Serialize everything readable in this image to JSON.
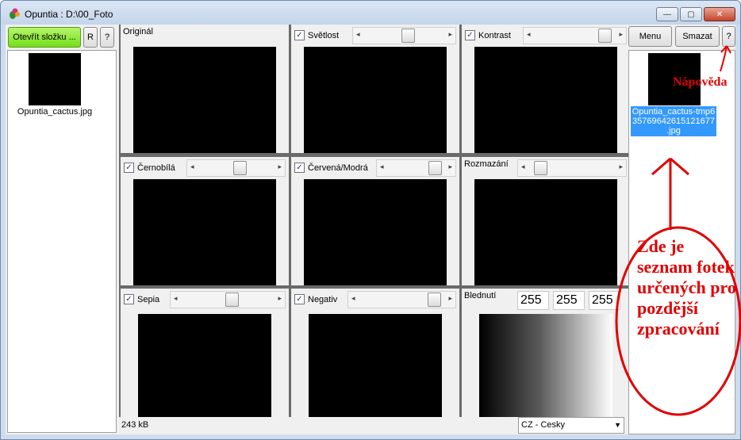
{
  "window": {
    "title": "Opuntia : D:\\00_Foto",
    "min_symbol": "—",
    "max_symbol": "▢",
    "close_symbol": "✕"
  },
  "left_panel": {
    "open_folder_label": "Otevřít složku ...",
    "r_label": "R",
    "help_label": "?",
    "files": [
      {
        "name": "Opuntia_cactus.jpg",
        "thumb_icon": "cactus-flower-thumbnail"
      }
    ]
  },
  "filters": [
    {
      "id": "original",
      "label": "Originál",
      "has_checkbox": false,
      "checked": false,
      "has_slider": false,
      "tint": "original"
    },
    {
      "id": "brightness",
      "label": "Světlost",
      "has_checkbox": true,
      "checked": true,
      "has_slider": true,
      "slider_value": 0.55,
      "tint": "bright"
    },
    {
      "id": "contrast",
      "label": "Kontrast",
      "has_checkbox": true,
      "checked": true,
      "has_slider": true,
      "slider_value": 0.95,
      "tint": "contrast"
    },
    {
      "id": "grayscale",
      "label": "Černobílá",
      "has_checkbox": true,
      "checked": true,
      "has_slider": true,
      "slider_value": 0.55,
      "tint": "gray"
    },
    {
      "id": "red-blue",
      "label": "Červená/Modrá",
      "has_checkbox": true,
      "checked": true,
      "has_slider": true,
      "slider_value": 0.95,
      "tint": "original"
    },
    {
      "id": "blur",
      "label": "Rozmazání",
      "has_checkbox": false,
      "checked": false,
      "has_slider": true,
      "slider_value": 0.05,
      "tint": "original"
    },
    {
      "id": "sepia",
      "label": "Sepia",
      "has_checkbox": true,
      "checked": true,
      "has_slider": true,
      "slider_value": 0.55,
      "tint": "sepia"
    },
    {
      "id": "negative",
      "label": "Negativ",
      "has_checkbox": true,
      "checked": true,
      "has_slider": true,
      "slider_value": 0.95,
      "tint": "negative"
    },
    {
      "id": "fade",
      "label": "Blednutí",
      "has_checkbox": false,
      "checked": false,
      "has_slider": false,
      "values": [
        "255",
        "255",
        "255"
      ],
      "tint": "fade"
    }
  ],
  "statusbar": {
    "size": "243 kB",
    "language": "CZ - Cesky",
    "dropdown_arrow": "▼"
  },
  "right_panel": {
    "menu_label": "Menu",
    "delete_label": "Smazat",
    "help_label": "?",
    "saved_files": [
      {
        "name": "Opuntia_cactus-tmp6 35769642615121677 .jpg",
        "thumb_icon": "cactus-flower-thumbnail"
      }
    ]
  },
  "annotations": {
    "help": "Nápověda",
    "note": "Zde je seznam fotek určených pro pozdější zpracování",
    "color": "#e00000"
  },
  "colors": {
    "open_button": "#84e52a",
    "selection": "#3399ff",
    "grid_background": "#6a6a6a",
    "annotation": "#e00000"
  }
}
